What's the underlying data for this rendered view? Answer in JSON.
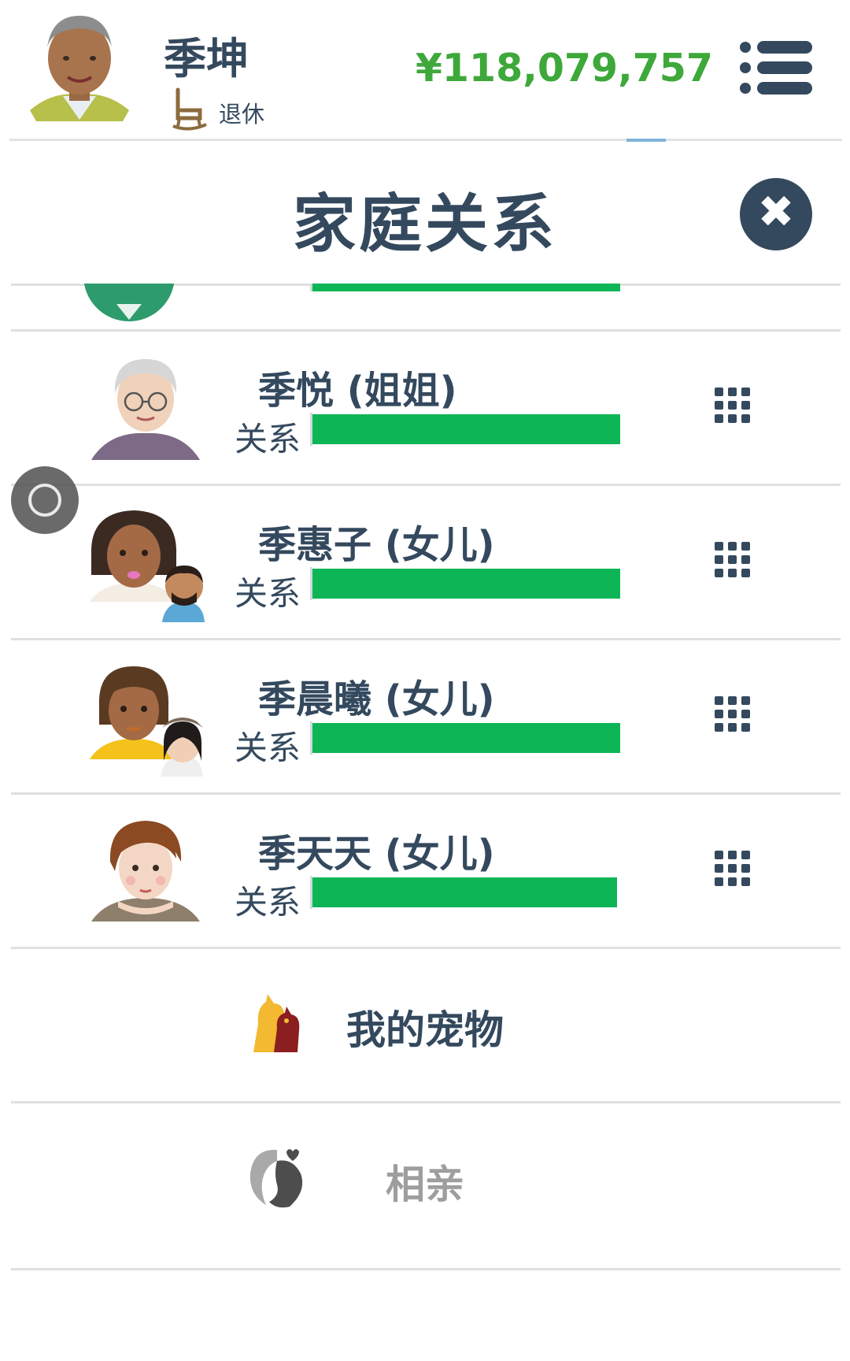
{
  "header": {
    "player_name": "季坤",
    "status": "退休",
    "money": "¥118,079,757"
  },
  "modal": {
    "title": "家庭关系"
  },
  "relation_label": "关系",
  "family": [
    {
      "name": "季悦 (姐姐)",
      "relationship_level": 1.0
    },
    {
      "name": "季惠子 (女儿)",
      "relationship_level": 1.0
    },
    {
      "name": "季晨曦 (女儿)",
      "relationship_level": 1.0
    },
    {
      "name": "季天天 (女儿)",
      "relationship_level": 0.99
    }
  ],
  "menu": {
    "pets": "我的宠物",
    "dating": "相亲"
  },
  "colors": {
    "primary": "#34495e",
    "money": "#3ea83a",
    "bar": "#0db556",
    "disabled": "#9e9e9e"
  }
}
